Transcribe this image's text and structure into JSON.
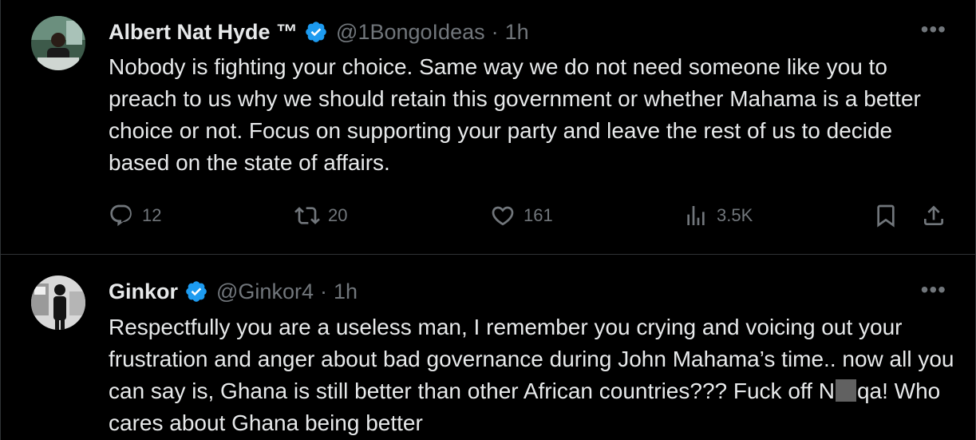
{
  "tweets": [
    {
      "name": "Albert Nat Hyde ™",
      "handle": "@1BongoIdeas",
      "time": "1h",
      "text": "Nobody is fighting your choice. Same way we do not need someone like you to preach to us why we should retain this government or whether Mahama is a better choice or not. Focus on supporting your party and leave the rest of us to decide based on the state of affairs.",
      "replies": "12",
      "retweets": "20",
      "likes": "161",
      "views": "3.5K"
    },
    {
      "name": "Ginkor",
      "handle": "@Ginkor4",
      "time": "1h",
      "text_before": "Respectfully you are a useless man, I remember you crying and voicing out your frustration and anger about bad governance during John Mahama’s time.. now all you can say is, Ghana is still better than other African countries??? Fuck off N",
      "text_after": "qa! Who cares about Ghana being better"
    }
  ],
  "ui": {
    "separator": "·",
    "more_label": "•••"
  },
  "colors": {
    "background": "#000000",
    "text": "#e7e9ea",
    "secondary": "#71767b",
    "verified": "#1d9bf0",
    "divider": "#2f3336"
  }
}
